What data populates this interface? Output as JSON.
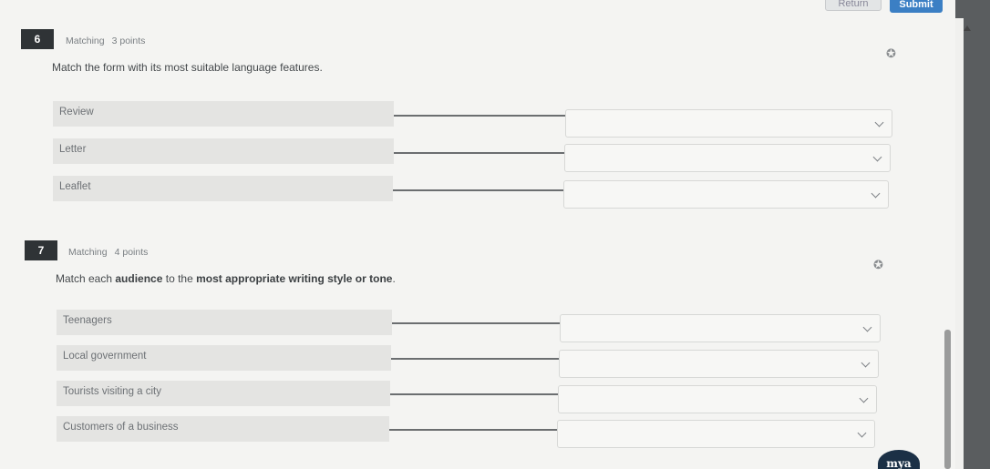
{
  "toolbar": {
    "return_label": "Return",
    "submit_label": "Submit"
  },
  "questions": [
    {
      "number": "6",
      "type": "Matching",
      "points": "3 points",
      "prompt": "Match the form with its most suitable language features.",
      "terms": [
        "Review",
        "Letter",
        "Leaflet"
      ]
    },
    {
      "number": "7",
      "type": "Matching",
      "points": "4 points",
      "prompt_pre": "Match each ",
      "prompt_bold1": "audience",
      "prompt_mid": " to the ",
      "prompt_bold2": "most appropriate writing style or tone",
      "prompt_post": ".",
      "terms": [
        "Teenagers",
        "Local government",
        "Tourists visiting a city",
        "Customers of a business"
      ]
    }
  ],
  "badge": "mya",
  "icons": {
    "pin": "pin-icon",
    "chevron": "chevron-down-icon",
    "scroll": "scroll-up-arrow-icon"
  },
  "colors": {
    "number_bg": "#2f3336",
    "submit": "#3b7fc4",
    "term_bg": "#e4e4e2"
  }
}
